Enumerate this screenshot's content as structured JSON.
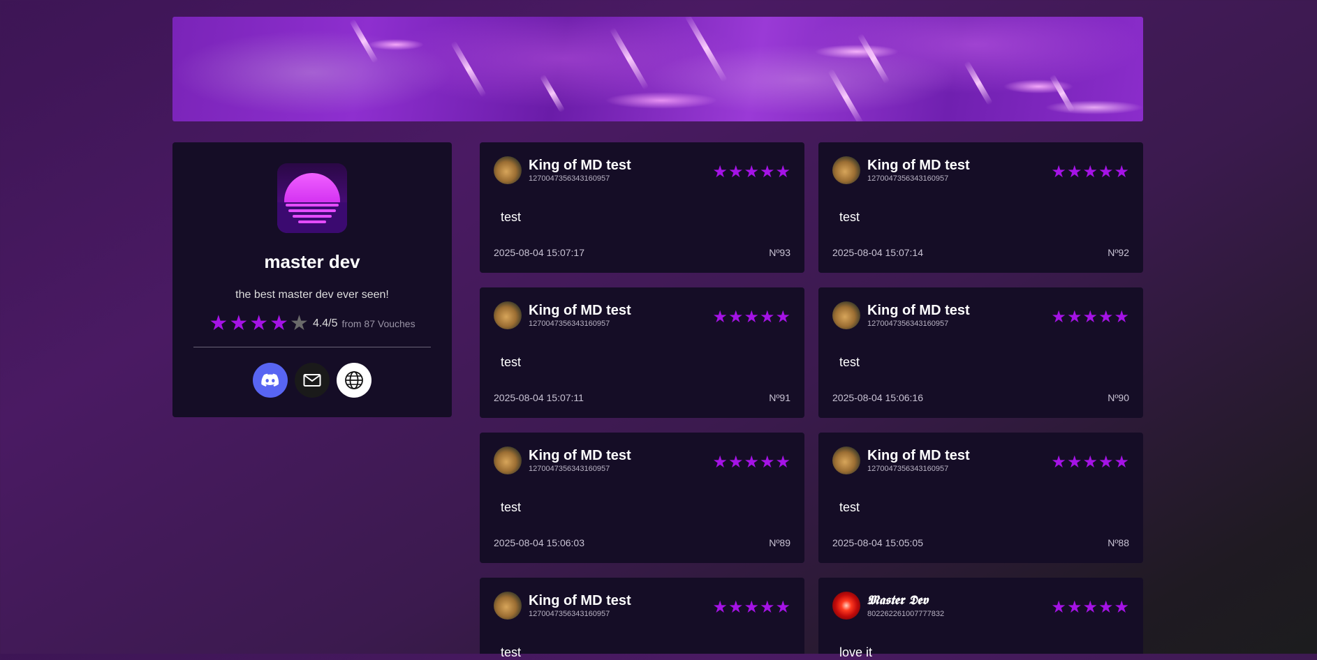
{
  "profile": {
    "name": "master dev",
    "bio": "the best master dev ever seen!",
    "rating": 4.4,
    "rating_text": "4.4/5",
    "vouch_text": "from 87 Vouches",
    "stars_filled": 4,
    "stars_total": 5,
    "socials": [
      {
        "name": "discord",
        "icon": "discord-icon",
        "color": "#5865f2"
      },
      {
        "name": "email",
        "icon": "mail-icon",
        "color": "#1a1a1a"
      },
      {
        "name": "website",
        "icon": "globe-icon",
        "color": "#ffffff"
      }
    ]
  },
  "colors": {
    "accent": "#a513e6",
    "card": "#150d26"
  },
  "vouches": [
    {
      "name": "King of MD test",
      "id": "1270047356343160957",
      "stars": 5,
      "text": "test",
      "date": "2025-08-04 15:07:17",
      "number": "Nº93"
    },
    {
      "name": "King of MD test",
      "id": "1270047356343160957",
      "stars": 5,
      "text": "test",
      "date": "2025-08-04 15:07:14",
      "number": "Nº92"
    },
    {
      "name": "King of MD test",
      "id": "1270047356343160957",
      "stars": 5,
      "text": "test",
      "date": "2025-08-04 15:07:11",
      "number": "Nº91"
    },
    {
      "name": "King of MD test",
      "id": "1270047356343160957",
      "stars": 5,
      "text": "test",
      "date": "2025-08-04 15:06:16",
      "number": "Nº90"
    },
    {
      "name": "King of MD test",
      "id": "1270047356343160957",
      "stars": 5,
      "text": "test",
      "date": "2025-08-04 15:06:03",
      "number": "Nº89"
    },
    {
      "name": "King of MD test",
      "id": "1270047356343160957",
      "stars": 5,
      "text": "test",
      "date": "2025-08-04 15:05:05",
      "number": "Nº88"
    },
    {
      "name": "King of MD test",
      "id": "1270047356343160957",
      "stars": 5,
      "text": "test",
      "date": "",
      "number": ""
    },
    {
      "name": "𝕸𝖆𝖘𝖙𝖊𝖗 𝕯𝖊𝖛",
      "id": "802262261007777832",
      "stars": 5,
      "text": "love it",
      "date": "",
      "number": ""
    }
  ]
}
